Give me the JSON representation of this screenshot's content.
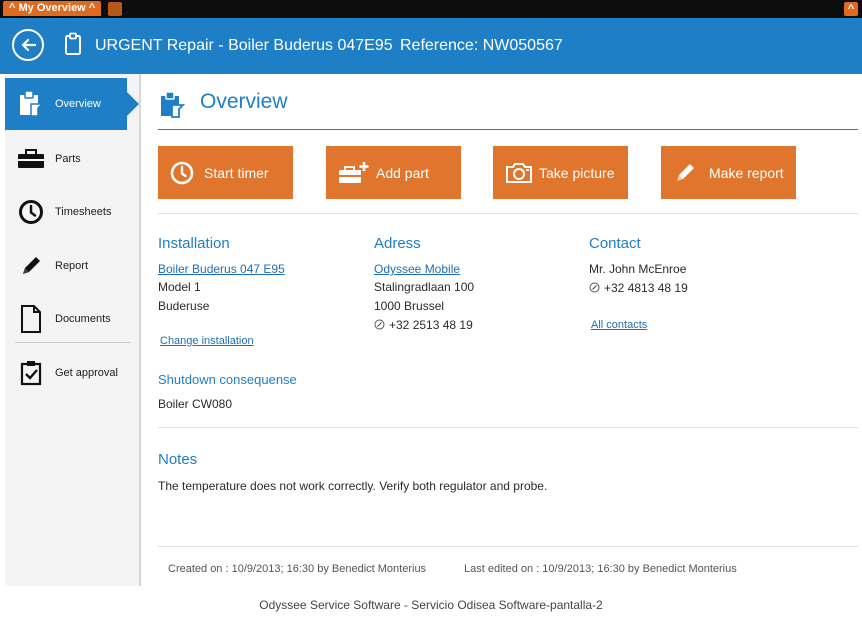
{
  "tabbar": {
    "tab_label": "^ My Overview ^",
    "collapse_label": "^"
  },
  "header": {
    "title": "URGENT Repair - Boiler Buderus 047E95",
    "reference": "Reference: NW050567"
  },
  "sidebar": {
    "items": [
      {
        "label": "Overview",
        "icon": "clipboard-icon"
      },
      {
        "label": "Parts",
        "icon": "toolbox-icon"
      },
      {
        "label": "Timesheets",
        "icon": "clock-icon"
      },
      {
        "label": "Report",
        "icon": "pencil-icon"
      },
      {
        "label": "Documents",
        "icon": "document-icon"
      },
      {
        "label": "Get approval",
        "icon": "checklist-icon"
      }
    ]
  },
  "main": {
    "title": "Overview",
    "actions": [
      {
        "label": "Start timer",
        "icon": "clock-icon"
      },
      {
        "label": "Add part",
        "icon": "toolbox-add-icon"
      },
      {
        "label": "Take picture",
        "icon": "camera-icon"
      },
      {
        "label": "Make report",
        "icon": "pencil-icon"
      }
    ],
    "installation": {
      "title": "Installation",
      "name": "Boiler Buderus 047 E95",
      "model": "Model 1",
      "brand": "Buderuse",
      "change_link": "Change installation"
    },
    "address": {
      "title": "Adress",
      "company": "Odyssee Mobile",
      "street": "Stalingradlaan 100",
      "city": "1000 Brussel",
      "phone": "+32 2513 48 19"
    },
    "contact": {
      "title": "Contact",
      "name": "Mr. John McEnroe",
      "phone": "+32 4813 48 19",
      "all_link": "All contacts"
    },
    "shutdown": {
      "title": "Shutdown consequense",
      "value": "Boiler CW080"
    },
    "notes": {
      "title": "Notes",
      "text": "The temperature does not work correctly. Verify both regulator and probe."
    },
    "footer": {
      "created": "Created on : 10/9/2013; 16:30 by Benedict Monterius",
      "edited": "Last edited on : 10/9/2013; 16:30 by Benedict Monterius"
    }
  },
  "caption": "Odyssee Service Software - Servicio Odisea Software-pantalla-2",
  "colors": {
    "header_blue": "#1e7fc6",
    "action_orange": "#e0752d",
    "tab_orange": "#e06b1f"
  }
}
